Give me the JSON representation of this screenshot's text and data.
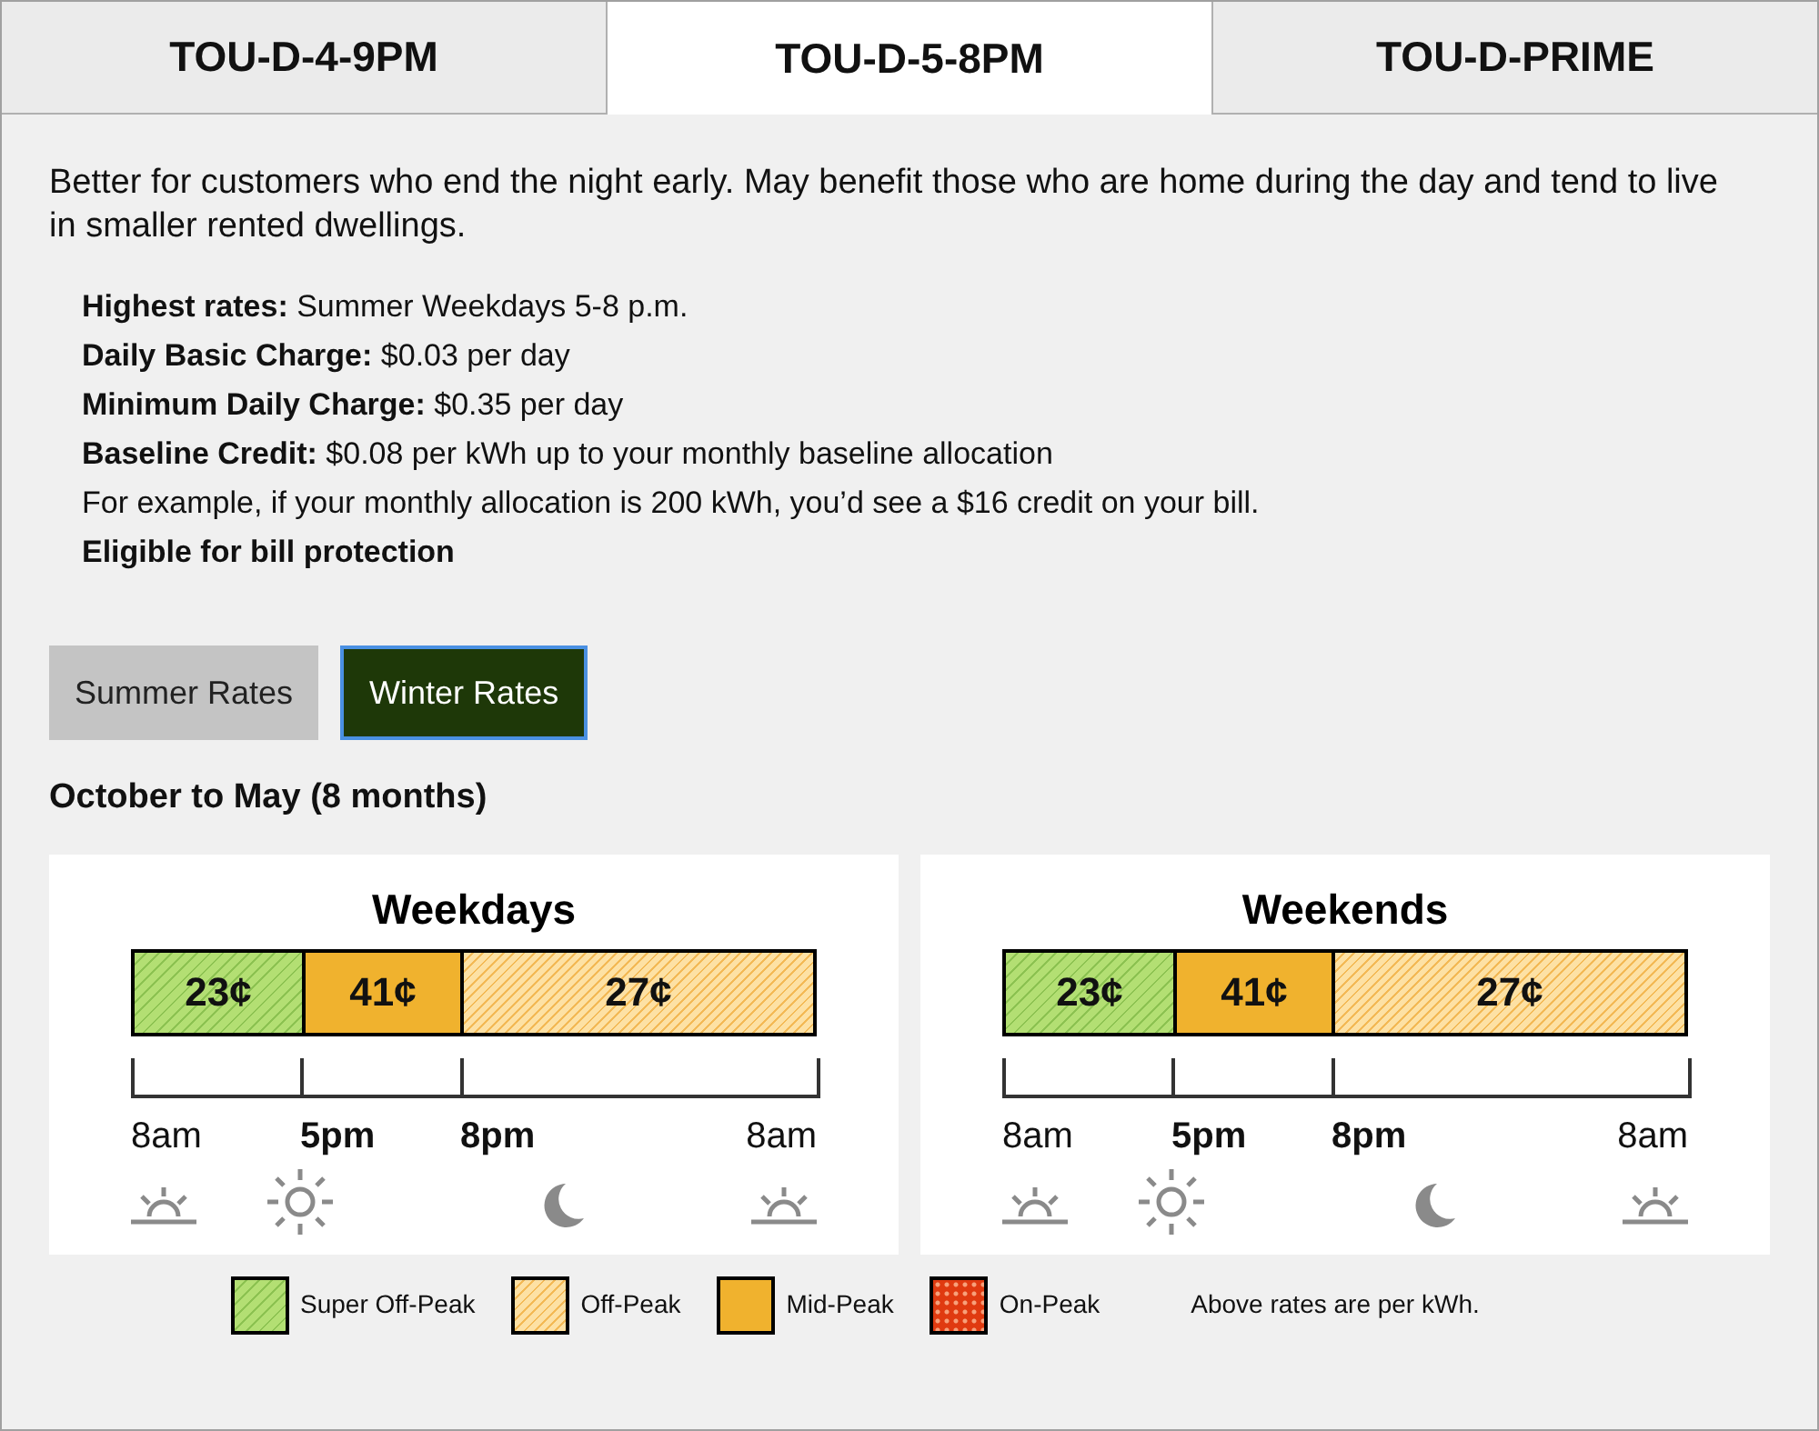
{
  "plan_tabs": [
    {
      "label": "TOU-D-4-9PM",
      "selected": false
    },
    {
      "label": "TOU-D-5-8PM",
      "selected": true
    },
    {
      "label": "TOU-D-PRIME",
      "selected": false
    }
  ],
  "description": "Better for customers who end the night early. May benefit those who are home during the day and tend to live in smaller rented dwellings.",
  "details": [
    "**Highest rates:** Summer Weekdays 5-8 p.m.",
    "**Daily Basic Charge:** $0.03 per day",
    "**Minimum Daily Charge:** $0.35 per day",
    "**Baseline Credit:** $0.08 per kWh up to your monthly baseline allocation",
    "For example, if your monthly allocation is 200 kWh, you’d see a $16 credit on your bill.",
    "**Eligible for bill protection**"
  ],
  "season_tabs": [
    {
      "label": "Summer Rates",
      "selected": false
    },
    {
      "label": "Winter Rates",
      "selected": true
    }
  ],
  "season_heading": "October to May (8 months)",
  "schedules": [
    {
      "title": "Weekdays",
      "segments": [
        {
          "kind": "super_off_peak",
          "rate": "23¢"
        },
        {
          "kind": "mid_peak",
          "rate": "41¢"
        },
        {
          "kind": "off_peak",
          "rate": "27¢"
        }
      ],
      "ticks": [
        {
          "label": "8am",
          "bold": false
        },
        {
          "label": "5pm",
          "bold": true
        },
        {
          "label": "8pm",
          "bold": true
        },
        {
          "label": "8am",
          "bold": false
        }
      ]
    },
    {
      "title": "Weekends",
      "segments": [
        {
          "kind": "super_off_peak",
          "rate": "23¢"
        },
        {
          "kind": "mid_peak",
          "rate": "41¢"
        },
        {
          "kind": "off_peak",
          "rate": "27¢"
        }
      ],
      "ticks": [
        {
          "label": "8am",
          "bold": false
        },
        {
          "label": "5pm",
          "bold": true
        },
        {
          "label": "8pm",
          "bold": true
        },
        {
          "label": "8am",
          "bold": false
        }
      ]
    }
  ],
  "legend": [
    {
      "kind": "super_off_peak",
      "label": "Super Off-Peak"
    },
    {
      "kind": "off_peak",
      "label": "Off-Peak"
    },
    {
      "kind": "mid_peak",
      "label": "Mid-Peak"
    },
    {
      "kind": "on_peak",
      "label": "On-Peak"
    }
  ],
  "legend_note": "Above rates are per kWh."
}
